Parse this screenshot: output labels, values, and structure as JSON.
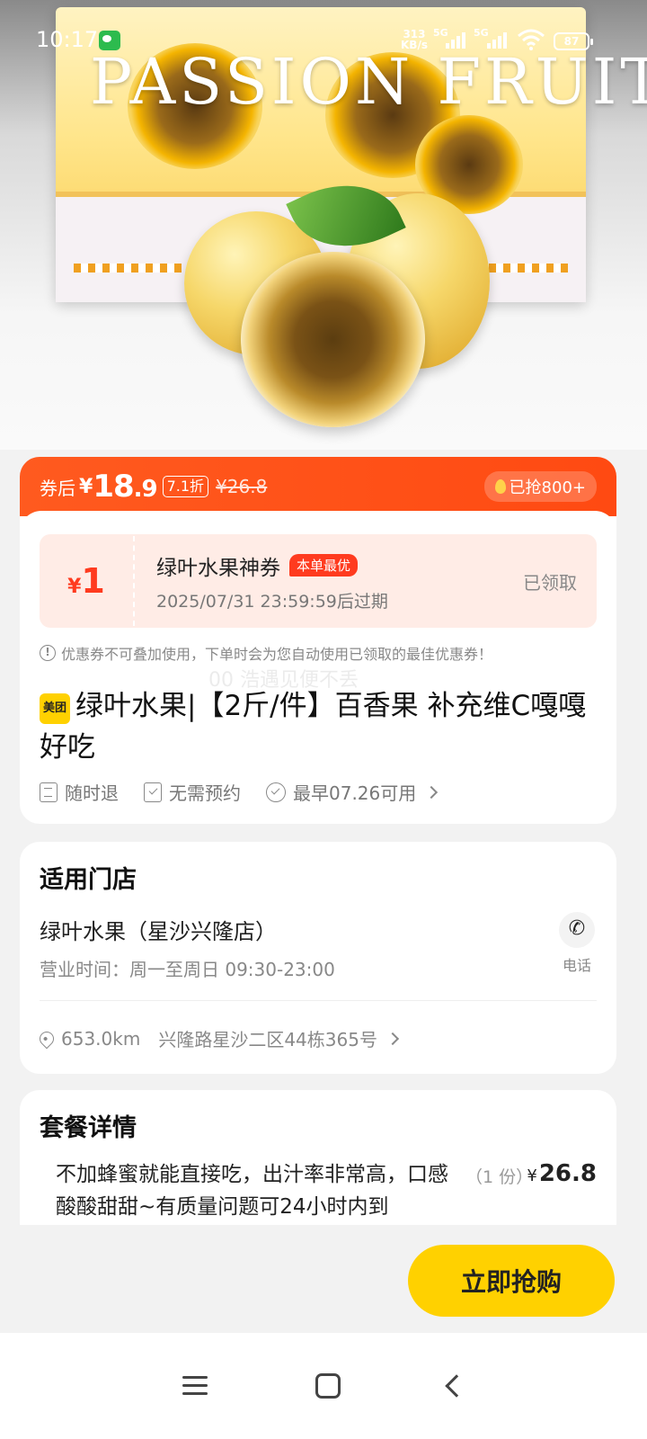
{
  "statusbar": {
    "time": "10:17",
    "net_speed_value": "313",
    "net_speed_unit": "KB/s",
    "sig1_label": "5G",
    "sig2_label": "5G",
    "battery": "87"
  },
  "hero": {
    "brand_text": "PASSION FRUIT"
  },
  "price_bar": {
    "label": "券后",
    "currency": "¥",
    "price_int": "18",
    "price_dec": ".9",
    "discount": "7.1折",
    "original_price": "¥26.8",
    "sold": "已抢800+"
  },
  "coupon": {
    "currency": "¥",
    "amount": "1",
    "name": "绿叶水果神券",
    "tag": "本单最优",
    "expire": "2025/07/31 23:59:59后过期",
    "status": "已领取"
  },
  "notice": "优惠券不可叠加使用，下单时会为您自动使用已领取的最佳优惠券！",
  "watermark": "00 浩遇见便不丢",
  "product": {
    "logo": "美团",
    "title": "绿叶水果|【2斤/件】百香果 补充维C嘎嘎好吃"
  },
  "features": [
    {
      "label": "随时退"
    },
    {
      "label": "无需预约"
    },
    {
      "label": "最早07.26可用"
    }
  ],
  "store": {
    "section_title": "适用门店",
    "name": "绿叶水果（星沙兴隆店）",
    "hours": "营业时间：周一至周日 09:30-23:00",
    "phone_label": "电话",
    "distance": "653.0km",
    "address": "兴隆路星沙二区44栋365号"
  },
  "package": {
    "section_title": "套餐详情",
    "description": "不加蜂蜜就能直接吃，出汁率非常高，口感酸酸甜甜~有质量问题可24小时内到",
    "quantity": "（1 份）",
    "currency": "¥",
    "price": "26.8"
  },
  "buy_button": "立即抢购",
  "colors": {
    "accent_orange": "#ff4a12",
    "coupon_red": "#ff3b1f",
    "buy_yellow": "#ffd100",
    "coupon_bg": "#ffece6"
  }
}
